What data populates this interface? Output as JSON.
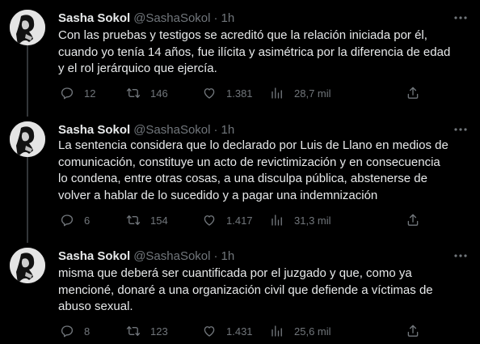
{
  "tweets": [
    {
      "name": "Sasha Sokol",
      "handle": "@SashaSokol",
      "separator": "·",
      "time": "1h",
      "text": "Con las pruebas y testigos se acreditó que la relación iniciada por él,\ncuando yo tenía 14 años, fue ilícita y asimétrica por la diferencia de edad\ny el rol jerárquico que ejercía.",
      "replies": "12",
      "retweets": "146",
      "likes": "1.381",
      "views": "28,7 mil"
    },
    {
      "name": "Sasha Sokol",
      "handle": "@SashaSokol",
      "separator": "·",
      "time": "1h",
      "text": "La sentencia considera que lo declarado por Luis de Llano en medios de\ncomunicación, constituye un acto de revictimización y en consecuencia\nlo condena, entre otras cosas, a una disculpa pública, abstenerse de\nvolver a hablar de lo sucedido y a pagar una indemnización",
      "replies": "6",
      "retweets": "154",
      "likes": "1.417",
      "views": "31,3 mil"
    },
    {
      "name": "Sasha Sokol",
      "handle": "@SashaSokol",
      "separator": "·",
      "time": "1h",
      "text": "misma que deberá ser cuantificada por el juzgado y que, como ya\nmencioné, donaré a una organización civil que defiende a víctimas de\nabuso sexual.",
      "replies": "8",
      "retweets": "123",
      "likes": "1.431",
      "views": "25,6 mil"
    }
  ],
  "icons": {
    "reply": "reply-icon",
    "retweet": "retweet-icon",
    "like": "heart-icon",
    "views": "views-chart-icon",
    "share": "share-icon",
    "more": "more-dots-icon"
  },
  "colors": {
    "background": "#000000",
    "text": "#e7e9ea",
    "muted": "#71767b",
    "thread_line": "#333639"
  }
}
